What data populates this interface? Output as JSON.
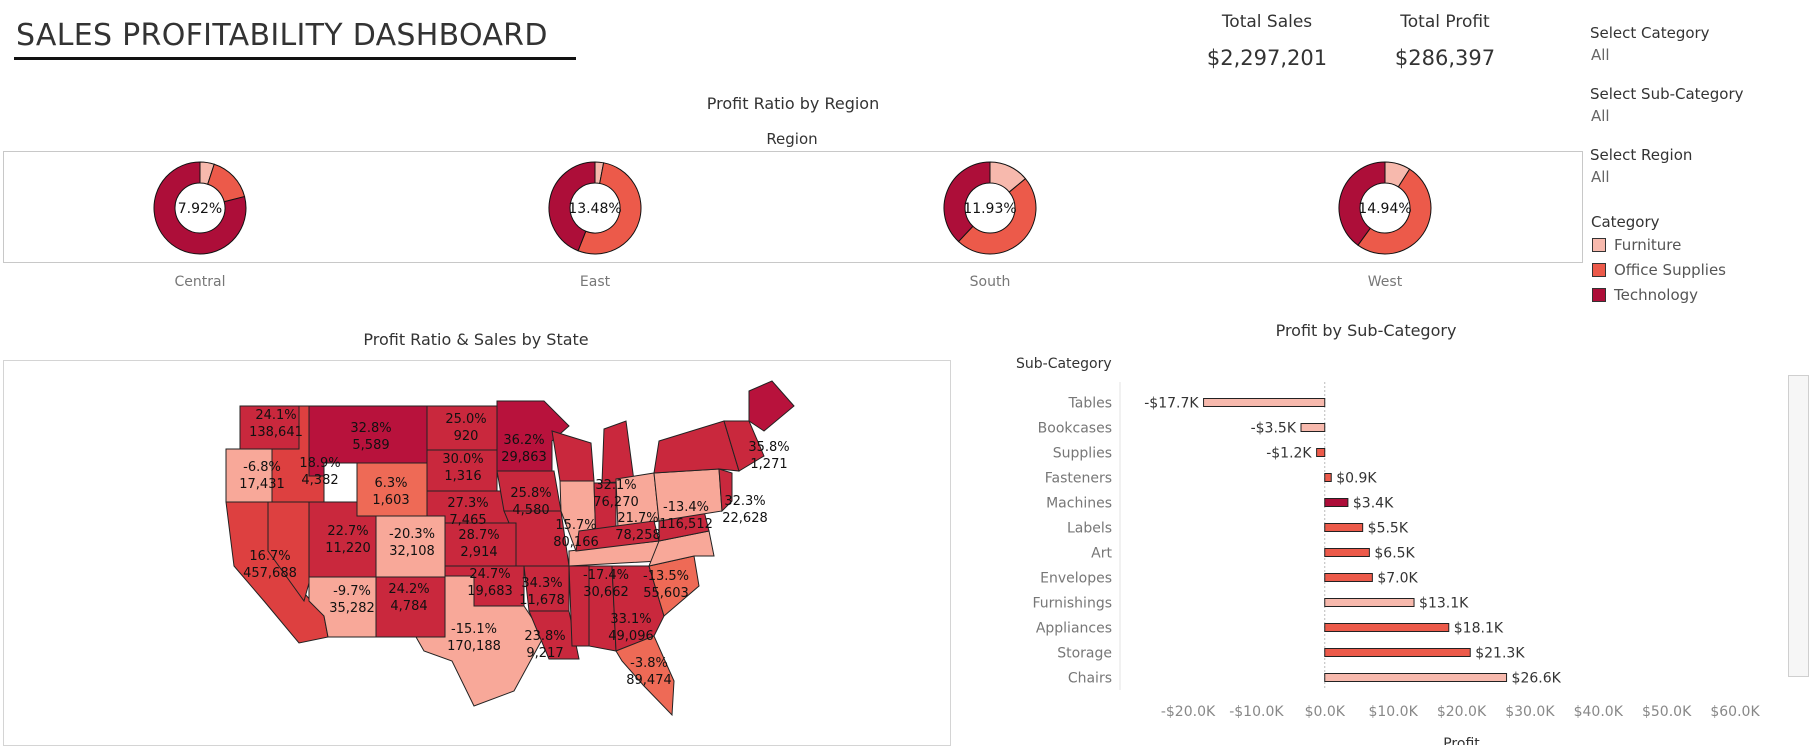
{
  "dashboard": {
    "title": "SALES PROFITABILITY DASHBOARD"
  },
  "kpis": [
    {
      "label": "Total Sales",
      "value": "$2,297,201"
    },
    {
      "label": "Total Profit",
      "value": "$286,397"
    }
  ],
  "filters": [
    {
      "label": "Select Category",
      "value": "All"
    },
    {
      "label": "Select Sub-Category",
      "value": "All"
    },
    {
      "label": "Select Region",
      "value": "All"
    }
  ],
  "legend": {
    "title": "Category",
    "items": [
      {
        "label": "Furniture",
        "color": "#f7b9ad"
      },
      {
        "label": "Office Supplies",
        "color": "#ec5a4a"
      },
      {
        "label": "Technology",
        "color": "#ad0e39"
      }
    ]
  },
  "region_section": {
    "title": "Profit Ratio by Region",
    "header": "Region"
  },
  "map_section": {
    "title": "Profit Ratio & Sales by State"
  },
  "bar_section": {
    "title": "Profit by Sub-Category"
  },
  "chart_data": [
    {
      "type": "pie",
      "title": "Profit Ratio by Region",
      "category_colors": {
        "Furniture": "#f7b9ad",
        "Office Supplies": "#ec5a4a",
        "Technology": "#ad0e39"
      },
      "regions": [
        {
          "name": "Central",
          "profit_ratio": "7.92%",
          "slices": [
            {
              "category": "Furniture",
              "share": 0.05
            },
            {
              "category": "Office Supplies",
              "share": 0.16
            },
            {
              "category": "Technology",
              "share": 0.79
            }
          ]
        },
        {
          "name": "East",
          "profit_ratio": "13.48%",
          "slices": [
            {
              "category": "Furniture",
              "share": 0.03
            },
            {
              "category": "Office Supplies",
              "share": 0.53
            },
            {
              "category": "Technology",
              "share": 0.44
            }
          ]
        },
        {
          "name": "South",
          "profit_ratio": "11.93%",
          "slices": [
            {
              "category": "Furniture",
              "share": 0.14
            },
            {
              "category": "Office Supplies",
              "share": 0.48
            },
            {
              "category": "Technology",
              "share": 0.38
            }
          ]
        },
        {
          "name": "West",
          "profit_ratio": "14.94%",
          "slices": [
            {
              "category": "Furniture",
              "share": 0.09
            },
            {
              "category": "Office Supplies",
              "share": 0.51
            },
            {
              "category": "Technology",
              "share": 0.4
            }
          ]
        }
      ]
    },
    {
      "type": "map",
      "title": "Profit Ratio & Sales by State",
      "states": [
        {
          "state": "Washington",
          "profit_ratio": "24.1%",
          "sales": "138,641"
        },
        {
          "state": "Oregon",
          "profit_ratio": "-6.8%",
          "sales": "17,431"
        },
        {
          "state": "California",
          "profit_ratio": "16.7%",
          "sales": "457,688"
        },
        {
          "state": "Idaho",
          "profit_ratio": "18.9%",
          "sales": "4,382"
        },
        {
          "state": "Montana",
          "profit_ratio": "32.8%",
          "sales": "5,589"
        },
        {
          "state": "Wyoming",
          "profit_ratio": "6.3%",
          "sales": "1,603"
        },
        {
          "state": "Utah",
          "profit_ratio": "22.7%",
          "sales": "11,220"
        },
        {
          "state": "Colorado",
          "profit_ratio": "-20.3%",
          "sales": "32,108"
        },
        {
          "state": "Arizona",
          "profit_ratio": "-9.7%",
          "sales": "35,282"
        },
        {
          "state": "New Mexico",
          "profit_ratio": "24.2%",
          "sales": "4,784"
        },
        {
          "state": "North Dakota",
          "profit_ratio": "25.0%",
          "sales": "920"
        },
        {
          "state": "South Dakota",
          "profit_ratio": "30.0%",
          "sales": "1,316"
        },
        {
          "state": "Nebraska",
          "profit_ratio": "27.3%",
          "sales": "7,465"
        },
        {
          "state": "Kansas",
          "profit_ratio": "28.7%",
          "sales": "2,914"
        },
        {
          "state": "Oklahoma",
          "profit_ratio": "24.7%",
          "sales": "19,683"
        },
        {
          "state": "Texas",
          "profit_ratio": "-15.1%",
          "sales": "170,188"
        },
        {
          "state": "Minnesota",
          "profit_ratio": "36.2%",
          "sales": "29,863"
        },
        {
          "state": "Iowa",
          "profit_ratio": "25.8%",
          "sales": "4,580"
        },
        {
          "state": "Illinois",
          "profit_ratio": "15.7%",
          "sales": "80,166"
        },
        {
          "state": "Michigan",
          "profit_ratio": "32.1%",
          "sales": "76,270"
        },
        {
          "state": "Ohio",
          "profit_ratio": "21.7%",
          "sales": "78,258"
        },
        {
          "state": "Pennsylvania",
          "profit_ratio": "-13.4%",
          "sales": "116,512"
        },
        {
          "state": "New York",
          "profit_ratio": "32.3%",
          "sales": "22,628"
        },
        {
          "state": "Maine",
          "profit_ratio": "35.8%",
          "sales": "1,271"
        },
        {
          "state": "Arkansas",
          "profit_ratio": "34.3%",
          "sales": "11,678"
        },
        {
          "state": "Louisiana",
          "profit_ratio": "23.8%",
          "sales": "9,217"
        },
        {
          "state": "Tennessee",
          "profit_ratio": "-17.4%",
          "sales": "30,662"
        },
        {
          "state": "North Carolina",
          "profit_ratio": "-13.5%",
          "sales": "55,603"
        },
        {
          "state": "Georgia",
          "profit_ratio": "33.1%",
          "sales": "49,096"
        },
        {
          "state": "Florida",
          "profit_ratio": "-3.8%",
          "sales": "89,474"
        }
      ]
    },
    {
      "type": "bar",
      "title": "Profit by Sub-Category",
      "y_header": "Sub-Category",
      "xlabel": "Profit",
      "xlim": [
        -20000,
        60000
      ],
      "x_ticks": [
        {
          "v": -20000,
          "label": "-$20.0K"
        },
        {
          "v": -10000,
          "label": "-$10.0K"
        },
        {
          "v": 0,
          "label": "$0.0K"
        },
        {
          "v": 10000,
          "label": "$10.0K"
        },
        {
          "v": 20000,
          "label": "$20.0K"
        },
        {
          "v": 30000,
          "label": "$30.0K"
        },
        {
          "v": 40000,
          "label": "$40.0K"
        },
        {
          "v": 50000,
          "label": "$50.0K"
        },
        {
          "v": 60000,
          "label": "$60.0K"
        }
      ],
      "categories": [
        "Tables",
        "Bookcases",
        "Supplies",
        "Fasteners",
        "Machines",
        "Labels",
        "Art",
        "Envelopes",
        "Furnishings",
        "Appliances",
        "Storage",
        "Chairs"
      ],
      "values": [
        -17725,
        -3473,
        -1189,
        950,
        3385,
        5546,
        6528,
        6964,
        13059,
        18138,
        21279,
        26590
      ],
      "value_labels": [
        "-$17.7K",
        "-$3.5K",
        "-$1.2K",
        "$0.9K",
        "$3.4K",
        "$5.5K",
        "$6.5K",
        "$7.0K",
        "$13.1K",
        "$18.1K",
        "$21.3K",
        "$26.6K"
      ],
      "bar_colors": [
        "#f7b9ad",
        "#f7b9ad",
        "#ec5a4a",
        "#ec5a4a",
        "#ad0e39",
        "#ec5a4a",
        "#ec5a4a",
        "#ec5a4a",
        "#f7b9ad",
        "#ec5a4a",
        "#ec5a4a",
        "#f7b9ad"
      ]
    }
  ],
  "map_colors": {
    "strong_positive": "#b8123c",
    "positive": "#c9283d",
    "moderate": "#dd4040",
    "low": "#ee6a56",
    "negative_light": "#f8a899",
    "state_border": "#222222"
  }
}
